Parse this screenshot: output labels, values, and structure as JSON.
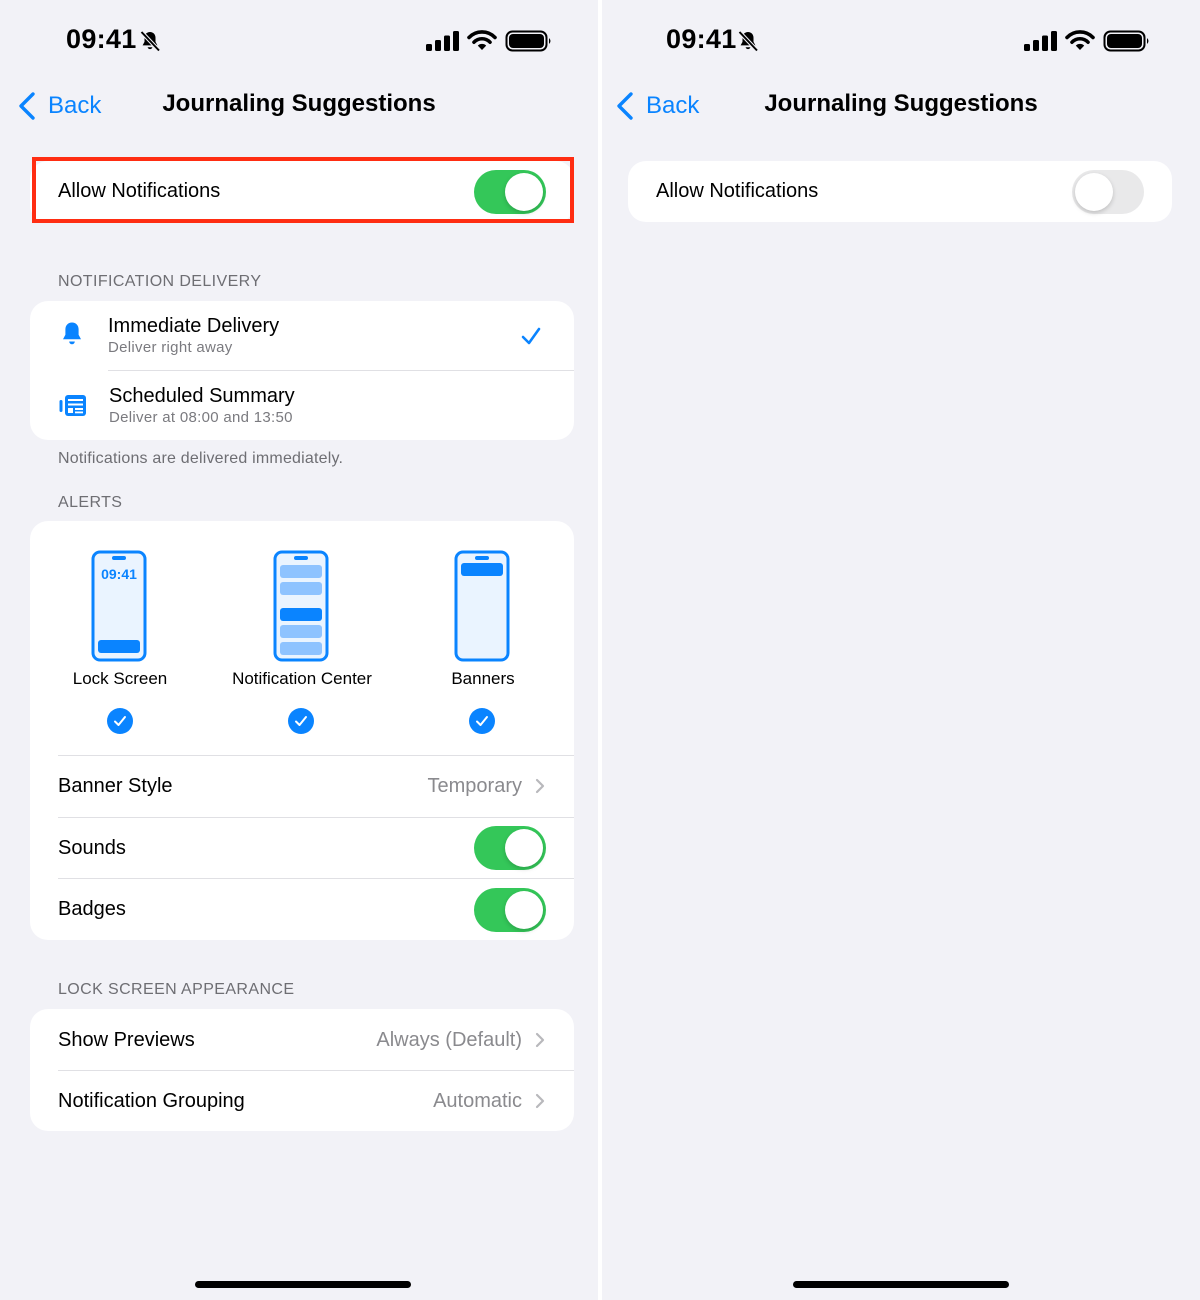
{
  "left_screen": {
    "status_bar": {
      "time": "09:41",
      "mute_icon": "bell-slash-icon",
      "signal_icon": "cellular-signal-icon",
      "wifi_icon": "wifi-icon",
      "battery_icon": "battery-full-icon"
    },
    "nav": {
      "back_label": "Back",
      "title": "Journaling Suggestions"
    },
    "allow_notifications": {
      "label": "Allow Notifications",
      "on": true,
      "highlighted": true
    },
    "notification_delivery": {
      "header": "NOTIFICATION DELIVERY",
      "options": [
        {
          "icon": "bell-icon",
          "title": "Immediate Delivery",
          "subtitle": "Deliver right away",
          "selected": true
        },
        {
          "icon": "scheduled-summary-icon",
          "title": "Scheduled Summary",
          "subtitle": "Deliver at 08:00 and 13:50",
          "selected": false
        }
      ],
      "footer": "Notifications are delivered immediately."
    },
    "alerts": {
      "header": "ALERTS",
      "phone_time": "09:41",
      "items": [
        {
          "label": "Lock Screen",
          "checked": true
        },
        {
          "label": "Notification Center",
          "checked": true
        },
        {
          "label": "Banners",
          "checked": true
        }
      ],
      "banner_style": {
        "label": "Banner Style",
        "value": "Temporary"
      },
      "sounds": {
        "label": "Sounds",
        "on": true
      },
      "badges": {
        "label": "Badges",
        "on": true
      }
    },
    "lock_screen_appearance": {
      "header": "LOCK SCREEN APPEARANCE",
      "show_previews": {
        "label": "Show Previews",
        "value": "Always (Default)"
      },
      "notification_grouping": {
        "label": "Notification Grouping",
        "value": "Automatic"
      }
    }
  },
  "right_screen": {
    "status_bar": {
      "time": "09:41"
    },
    "nav": {
      "back_label": "Back",
      "title": "Journaling Suggestions"
    },
    "allow_notifications": {
      "label": "Allow Notifications",
      "on": false
    }
  },
  "colors": {
    "accent": "#0a84ff",
    "toggle_on": "#34c759",
    "toggle_off": "#e9e9ea",
    "highlight": "#ff2d12",
    "background": "#f2f2f7"
  }
}
